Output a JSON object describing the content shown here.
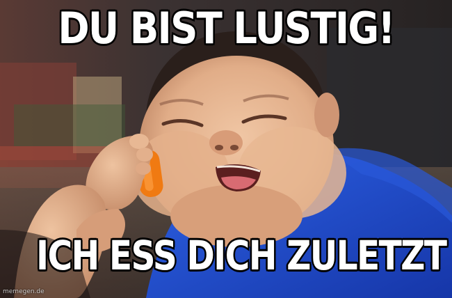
{
  "meme": {
    "top_text": "DU BIST LUSTIG!",
    "bottom_text": "ICH ESS DICH ZULETZT ...",
    "watermark": "memegen.de"
  },
  "colors": {
    "caption_fill": "#ffffff",
    "caption_stroke": "#000000",
    "shirt": "#1f4fd6",
    "phone": "#f07a12",
    "skin": "#e7b894"
  }
}
